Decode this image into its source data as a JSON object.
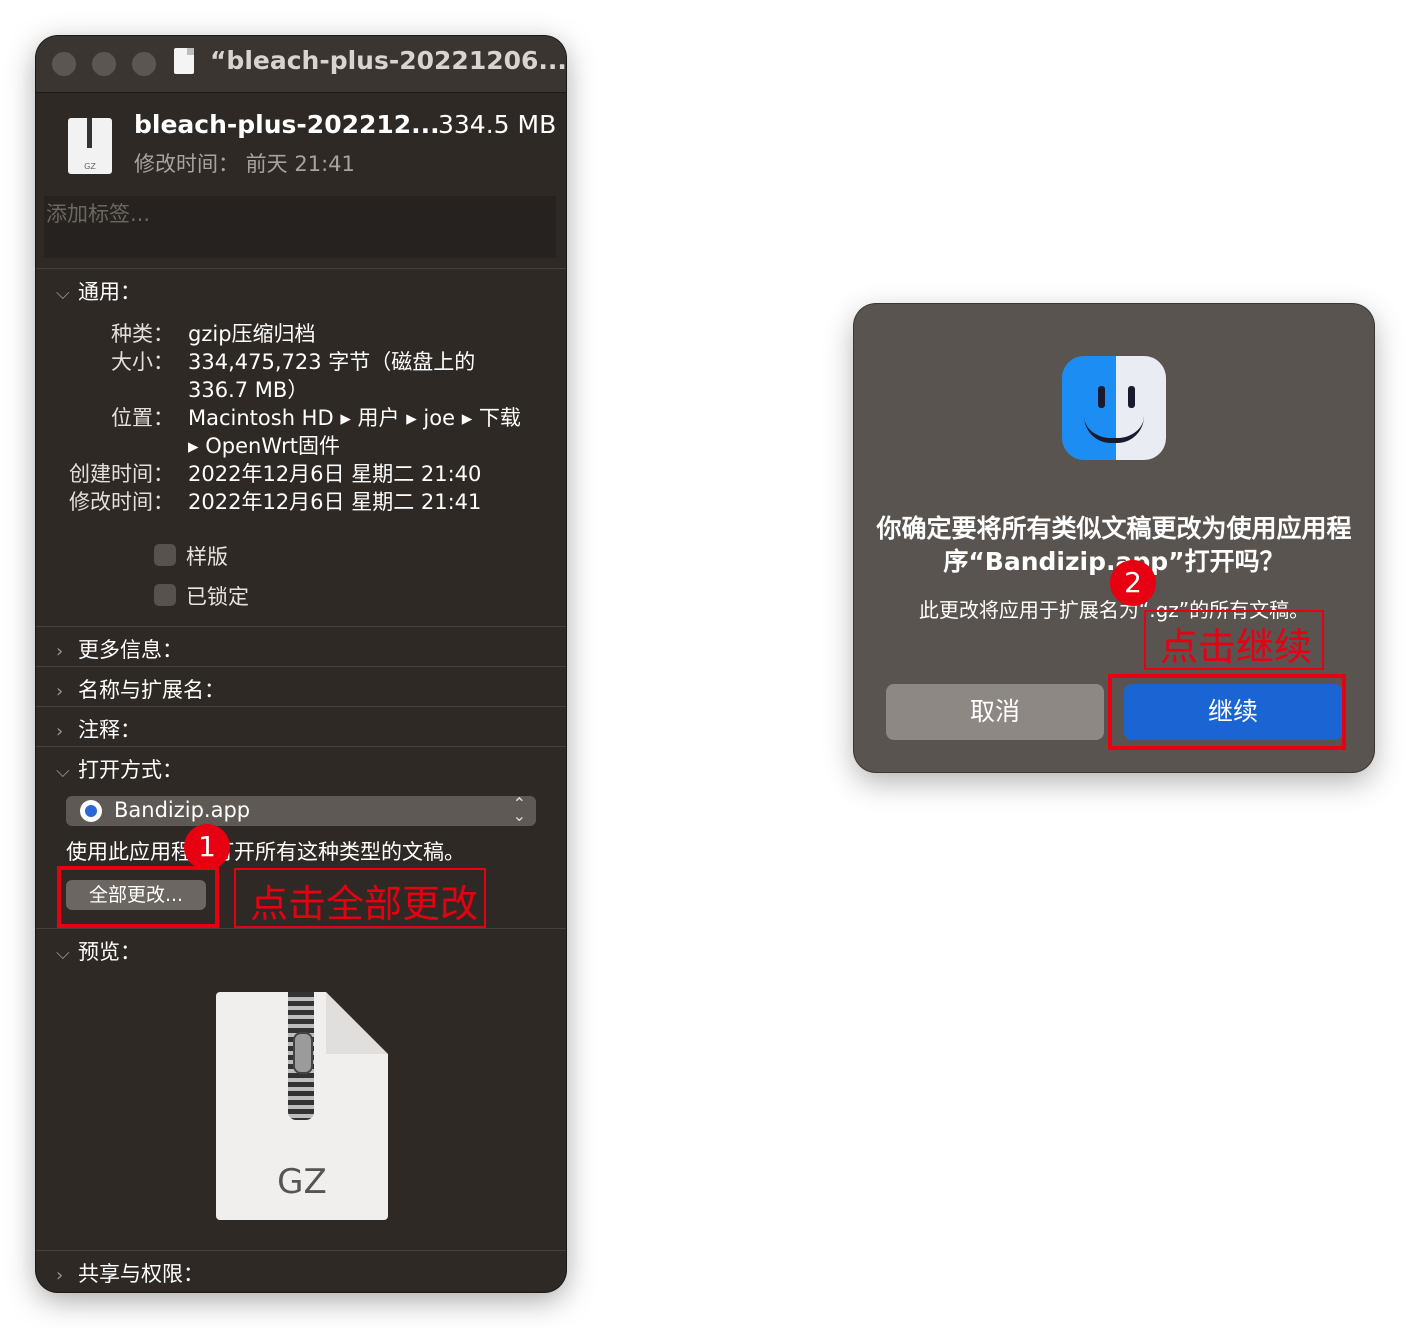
{
  "window": {
    "title": "“bleach-plus-20221206...",
    "file_name": "bleach-plus-202212...",
    "file_size": "334.5 MB",
    "modified_short": "修改时间： 前天 21:41",
    "file_icon_ext": "GZ",
    "tags_placeholder": "添加标签..."
  },
  "general": {
    "header": "通用：",
    "rows": [
      {
        "label": "种类：",
        "value": "gzip压缩归档"
      },
      {
        "label": "大小：",
        "value": "334,475,723 字节（磁盘上的"
      },
      {
        "label": "",
        "value": "336.7 MB）"
      },
      {
        "label": "位置：",
        "value": "Macintosh HD ▸ 用户 ▸ joe ▸ 下载"
      },
      {
        "label": "",
        "value": "▸ OpenWrt固件"
      },
      {
        "label": "创建时间：",
        "value": "2022年12月6日 星期二 21:40"
      },
      {
        "label": "修改时间：",
        "value": "2022年12月6日 星期二 21:41"
      }
    ],
    "stationery_label": "样版",
    "locked_label": "已锁定"
  },
  "sections": {
    "more_info": "更多信息：",
    "name_ext": "名称与扩展名：",
    "comments": "注释：",
    "open_with": "打开方式：",
    "preview": "预览：",
    "sharing": "共享与权限："
  },
  "open_with": {
    "app": "Bandizip.app",
    "use_text": "使用此应用程序打开所有这种类型的文稿。",
    "change_all": "全部更改..."
  },
  "preview": {
    "ext": "GZ"
  },
  "dialog": {
    "title": "你确定要将所有类似文稿更改为使用应用程序“Bandizip.app”打开吗？",
    "message": "此更改将应用于扩展名为“.gz”的所有文稿。",
    "cancel": "取消",
    "continue": "继续"
  },
  "annotations": {
    "step1": "1",
    "step1_text": "点击全部更改",
    "step2": "2",
    "step2_text": "点击继续"
  },
  "colors": {
    "accent_blue": "#1a64d3",
    "annotation_red": "#e60012"
  }
}
